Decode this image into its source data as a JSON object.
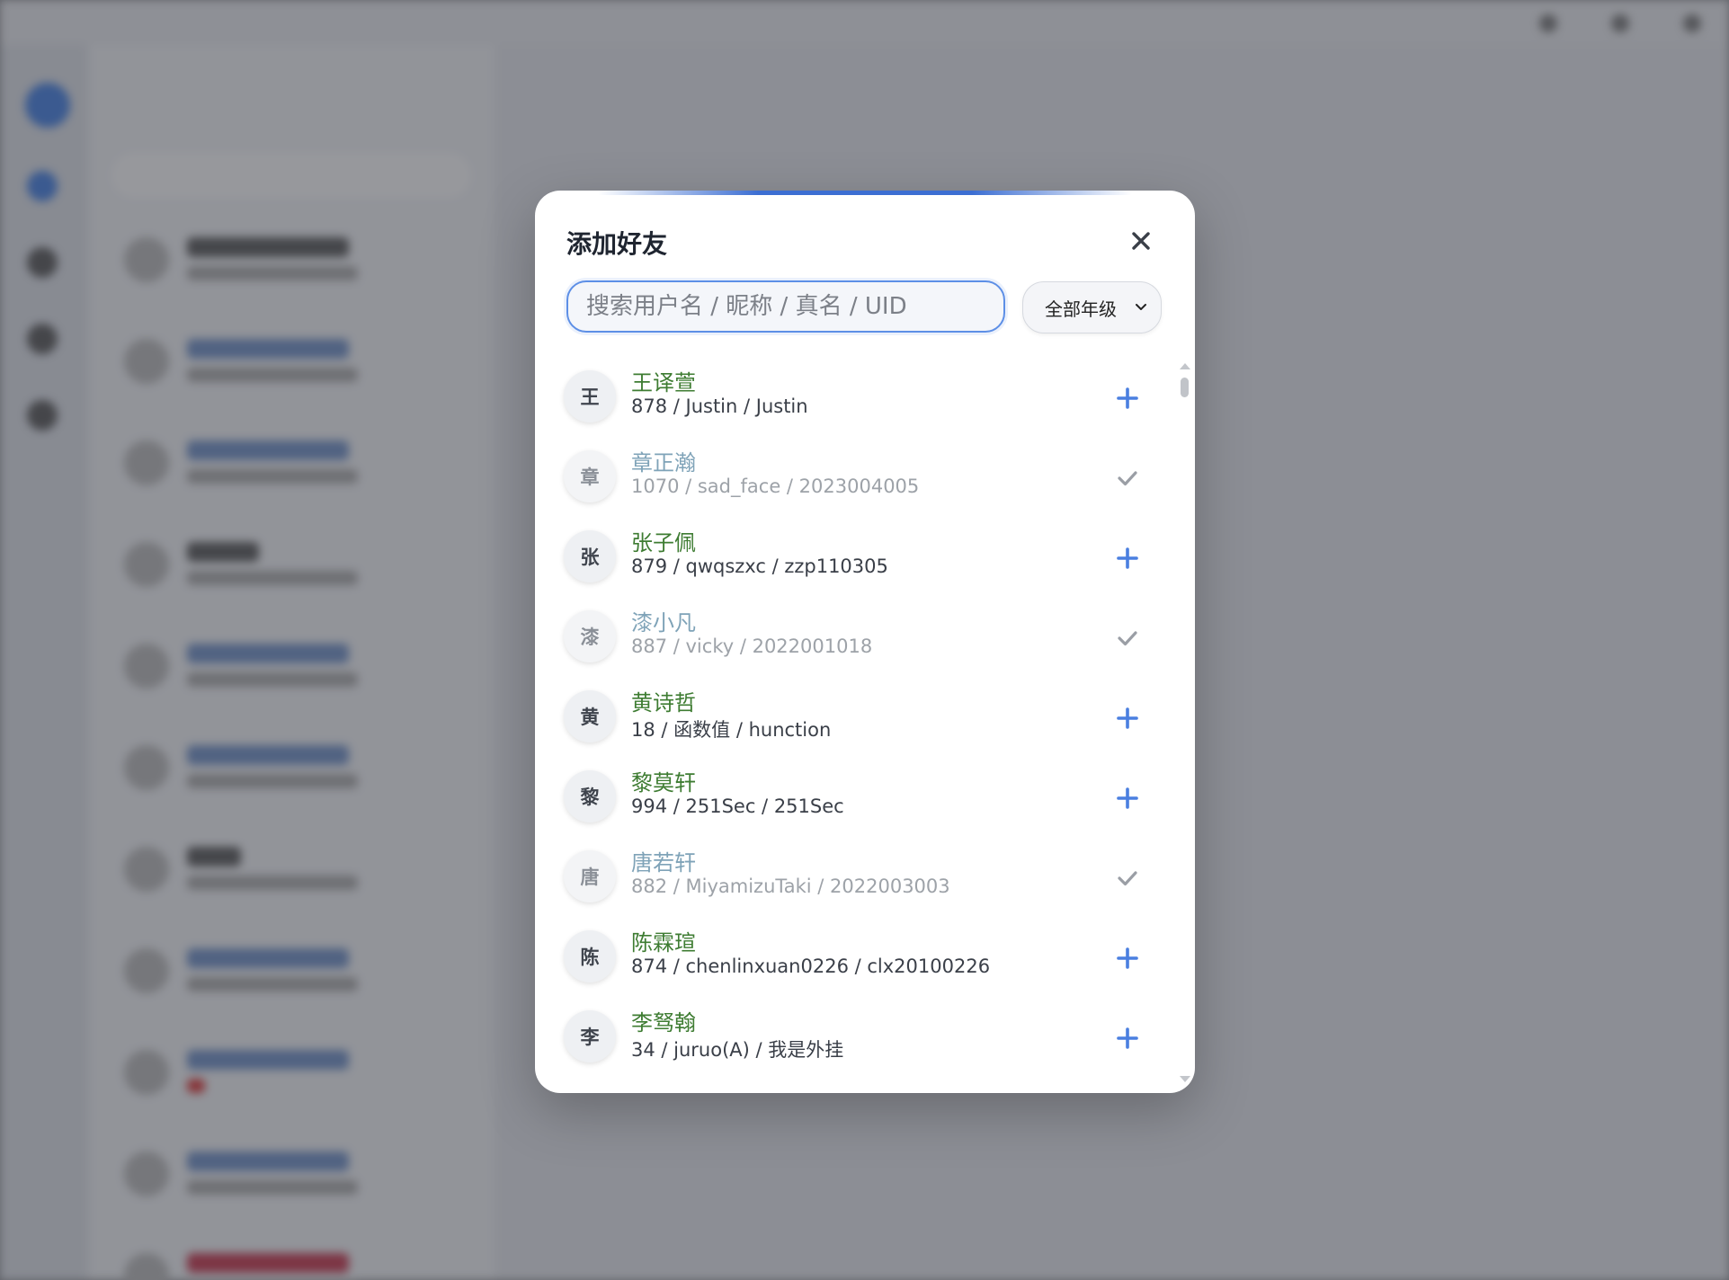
{
  "modal": {
    "title": "添加好友",
    "search_placeholder": "搜索用户名 / 昵称 / 真名 / UID",
    "search_value": "",
    "grade_filter": "全部年级"
  },
  "users": [
    {
      "avatar": "王",
      "name": "王译萱",
      "meta": "878 / Justin / Justin",
      "added": false
    },
    {
      "avatar": "章",
      "name": "章正瀚",
      "meta": "1070 / sad_face / 2023004005",
      "added": true
    },
    {
      "avatar": "张",
      "name": "张子佩",
      "meta": "879 / qwqszxc / zzp110305",
      "added": false
    },
    {
      "avatar": "漆",
      "name": "漆小凡",
      "meta": "887 / vicky / 2022001018",
      "added": true
    },
    {
      "avatar": "黄",
      "name": "黄诗哲",
      "meta": "18 / 函数值 / hunction",
      "added": false
    },
    {
      "avatar": "黎",
      "name": "黎莫轩",
      "meta": "994 / 251Sec / 251Sec",
      "added": false
    },
    {
      "avatar": "唐",
      "name": "唐若轩",
      "meta": "882 / MiyamizuTaki / 2022003003",
      "added": true
    },
    {
      "avatar": "陈",
      "name": "陈霖瑄",
      "meta": "874 / chenlinxuan0226 / clx20100226",
      "added": false
    },
    {
      "avatar": "李",
      "name": "李驽翰",
      "meta": "34 / juruo(A) / 我是外挂",
      "added": false
    }
  ],
  "icons": {
    "close": "close-icon",
    "add": "plus-icon",
    "added": "check-icon",
    "dropdown": "chevron-down-icon"
  },
  "colors": {
    "accent": "#4a7fe0",
    "name_green": "#3e7c32",
    "name_added": "#7fa3b8",
    "check_gray": "#9a9ea5"
  }
}
